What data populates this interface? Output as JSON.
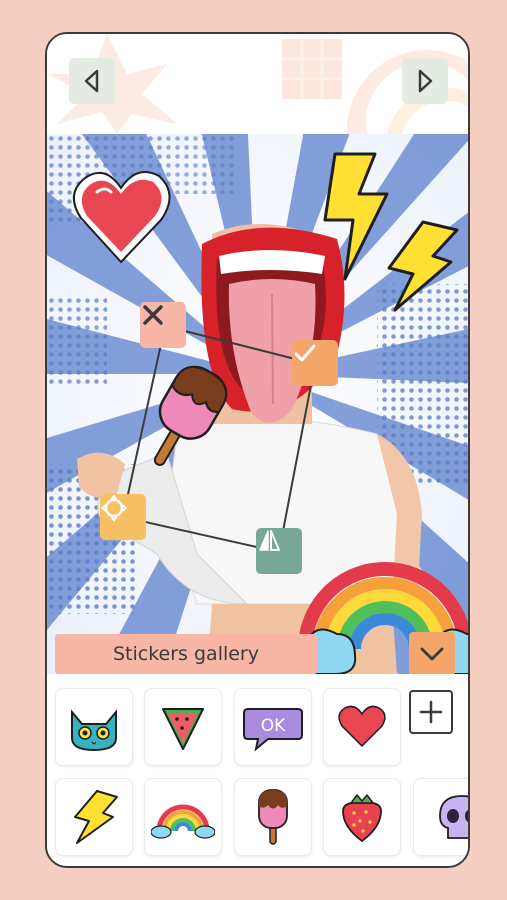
{
  "app": {
    "background_color": "#f6cfc3",
    "accent_color": "#f4a56a"
  },
  "toolbar": {
    "prev_icon": "chevron-left-icon",
    "next_icon": "chevron-right-icon"
  },
  "editor": {
    "photo_subject": "woman-with-mouth-head-collage",
    "stickers_on_canvas": [
      "heart",
      "lightning-bolt",
      "lightning-bolt-small",
      "popsicle",
      "rainbow"
    ],
    "selection_controls": {
      "delete_icon": "close-icon",
      "confirm_icon": "check-icon",
      "rotate_icon": "rotate-icon",
      "flip_icon": "flip-icon"
    }
  },
  "gallery": {
    "title": "Stickers gallery",
    "toggle_icon": "chevron-down-icon",
    "add_icon": "plus-icon",
    "stickers": [
      {
        "name": "cat",
        "label": ""
      },
      {
        "name": "watermelon",
        "label": ""
      },
      {
        "name": "ok-bubble",
        "label": "OK"
      },
      {
        "name": "heart",
        "label": ""
      },
      {
        "name": "lightning",
        "label": ""
      },
      {
        "name": "rainbow",
        "label": ""
      },
      {
        "name": "popsicle",
        "label": ""
      },
      {
        "name": "strawberry",
        "label": ""
      },
      {
        "name": "skull",
        "label": ""
      }
    ]
  }
}
